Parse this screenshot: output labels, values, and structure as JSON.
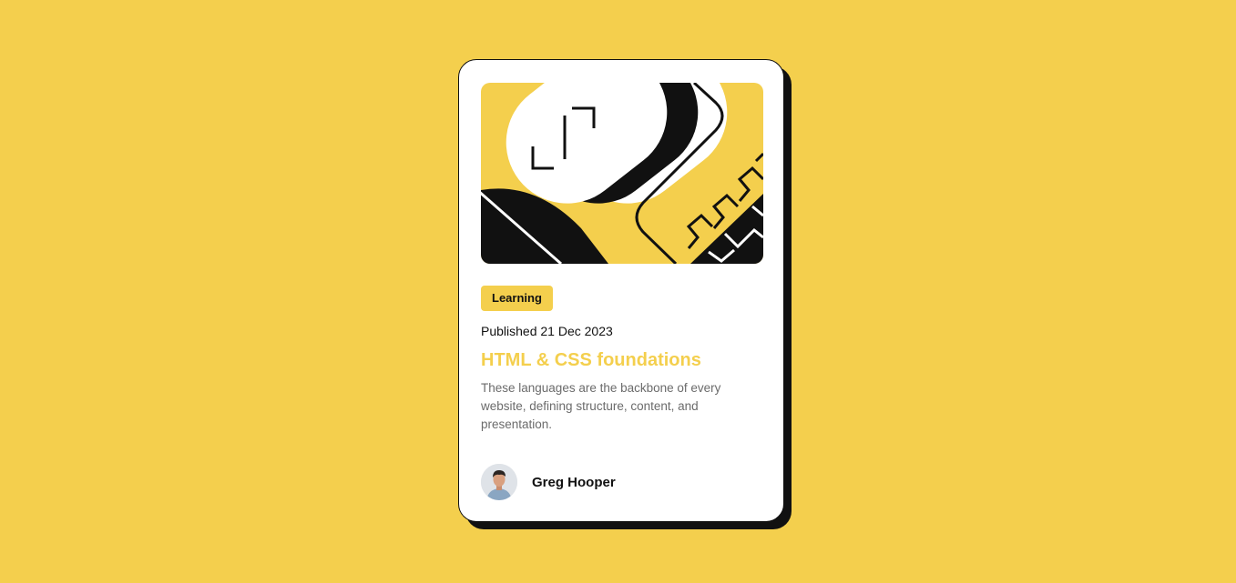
{
  "card": {
    "tag": "Learning",
    "published": "Published 21 Dec 2023",
    "title": "HTML & CSS foundations",
    "description": "These languages are the backbone of every website, defining structure, content, and presentation.",
    "author": {
      "name": "Greg Hooper",
      "avatar_icon": "person-avatar"
    },
    "illustration_icon": "abstract-geometric-illustration"
  },
  "colors": {
    "background": "#F4CF4D",
    "card": "#FFFFFF",
    "ink": "#111111",
    "accent": "#F4CF4D",
    "muted_text": "#6B6B6B"
  }
}
